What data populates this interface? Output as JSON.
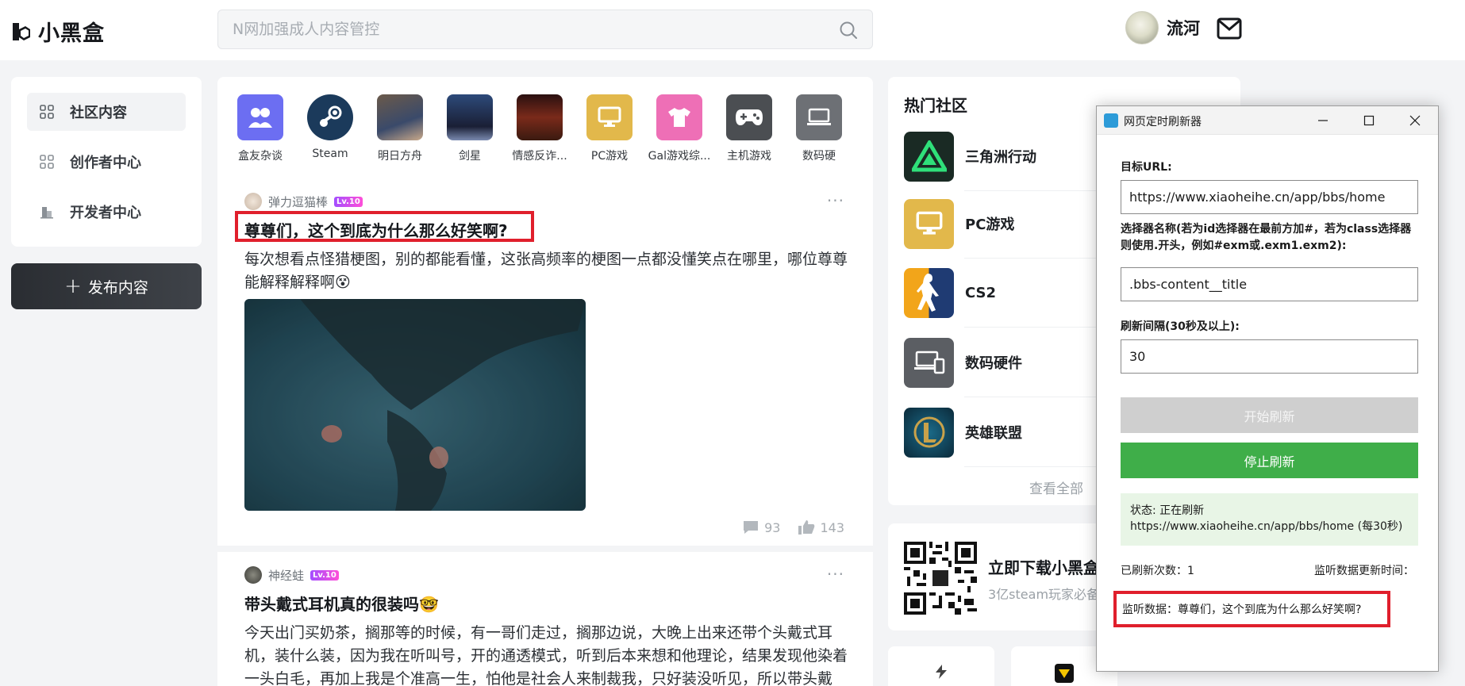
{
  "header": {
    "logo_text": "小黑盒",
    "search_placeholder": "N网加强成人内容管控",
    "username": "流河"
  },
  "sidebar": {
    "items": [
      {
        "label": "社区内容",
        "icon": "grid-icon"
      },
      {
        "label": "创作者中心",
        "icon": "grid-icon"
      },
      {
        "label": "开发者中心",
        "icon": "building-icon"
      }
    ],
    "publish_label": "发布内容"
  },
  "channels": [
    {
      "label": "盒友杂谈",
      "icon": "people-icon",
      "color": "#6c6ef2"
    },
    {
      "label": "Steam",
      "icon": "steam-icon",
      "color": "#1b3a5b"
    },
    {
      "label": "明日方舟",
      "icon": "anime-girl-icon",
      "color": "#4a5a7a"
    },
    {
      "label": "剑星",
      "icon": "character-icon",
      "color": "#2a3550"
    },
    {
      "label": "情感反诈...",
      "icon": "scene-icon",
      "color": "#5a1f1f"
    },
    {
      "label": "PC游戏",
      "icon": "monitor-icon",
      "color": "#e2b84b"
    },
    {
      "label": "Gal游戏综...",
      "icon": "shirt-icon",
      "color": "#ee6fb6"
    },
    {
      "label": "主机游戏",
      "icon": "gamepad-icon",
      "color": "#4b4e52"
    },
    {
      "label": "数码硬",
      "icon": "laptop-icon",
      "color": "#6d7075"
    }
  ],
  "posts": [
    {
      "author": "弹力逗猫棒",
      "level": "Lv.10",
      "title": "尊尊们，这个到底为什么那么好笑啊?",
      "body": "每次想看点怪猎梗图，别的都能看懂，这张高频率的梗图一点都没懂笑点在哪里，哪位尊尊能解释解释啊😵",
      "comments": "93",
      "likes": "143"
    },
    {
      "author": "神经蛙",
      "level": "Lv.10",
      "title": "带头戴式耳机真的很装吗🤓",
      "body": "今天出门买奶茶，搁那等的时候，有一哥们走过，搁那边说，大晚上出来还带个头戴式耳机，装什么装，因为我在听叫号，开的通透模式，听到后本来想和他理论，结果发现他染着一头白毛，再加上我是个准高一生，怕他是社会人来制裁我，只好装没听见，所以带头戴"
    }
  ],
  "community": {
    "title": "热门社区",
    "items": [
      {
        "name": "三角洲行动",
        "icon": "delta-icon",
        "color": "#1a2a24"
      },
      {
        "name": "PC游戏",
        "icon": "monitor-icon",
        "color": "#e2b84b"
      },
      {
        "name": "CS2",
        "icon": "cs2-icon",
        "color": "#1f3b73"
      },
      {
        "name": "数码硬件",
        "icon": "devices-icon",
        "color": "#5b5e63"
      },
      {
        "name": "英雄联盟",
        "icon": "lol-icon",
        "color": "#0b2a3a"
      }
    ],
    "view_all": "查看全部"
  },
  "download": {
    "title": "立即下载小黑盒",
    "subtitle": "3亿steam玩家必备"
  },
  "refresher": {
    "window_title": "网页定时刷新器",
    "url_label": "目标URL:",
    "url_value": "https://www.xiaoheihe.cn/app/bbs/home",
    "selector_label": "选择器名称(若为id选择器在最前方加#，若为class选择器则使用.开头，例如#exm或.exm1.exm2):",
    "selector_value": ".bbs-content__title",
    "interval_label": "刷新间隔(30秒及以上):",
    "interval_value": "30",
    "start_label": "开始刷新",
    "stop_label": "停止刷新",
    "status_line1": "状态: 正在刷新",
    "status_line2": "https://www.xiaoheihe.cn/app/bbs/home (每30秒)",
    "refresh_count": "已刷新次数：1",
    "update_time_label": "监听数据更新时间：",
    "monitor_text": "监听数据：尊尊们，这个到底为什么那么好笑啊?"
  }
}
